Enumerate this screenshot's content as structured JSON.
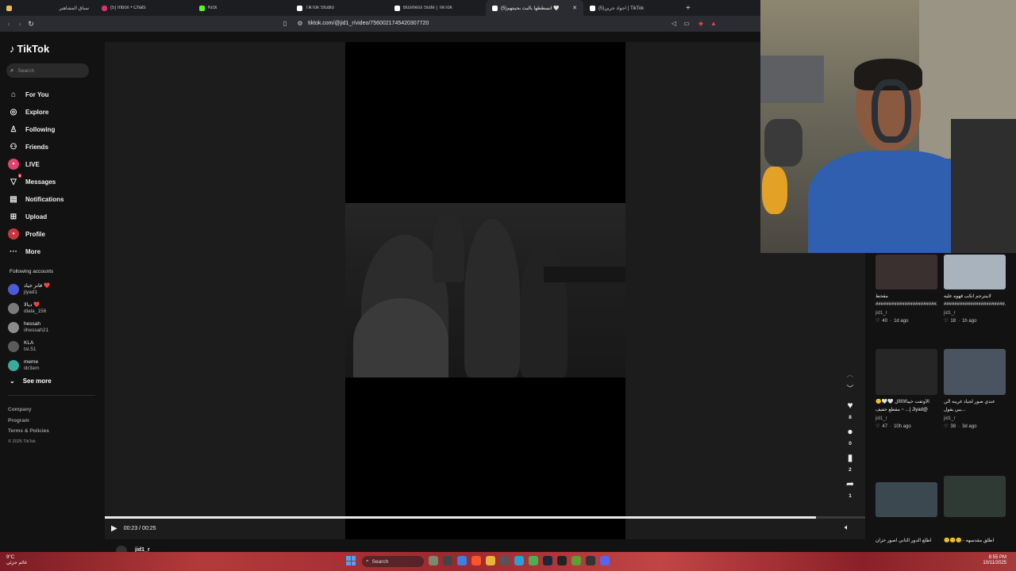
{
  "browser": {
    "tabs": [
      {
        "title": "سباق المشاهير",
        "favicon_color": "#e6c14a"
      },
      {
        "title": "(5) Inbox • Chats",
        "favicon_color": "#e1306c"
      },
      {
        "title": "Kick",
        "favicon_color": "#53fc18"
      },
      {
        "title": "TikTok Studio",
        "favicon_color": "#ffffff"
      },
      {
        "title": "Business Suite | TikTok",
        "favicon_color": "#ffffff"
      },
      {
        "title": "(5)انسطظها بالبث بحيبتهم 🤍",
        "favicon_color": "#ffffff",
        "active": true
      },
      {
        "title": "(5)اجواد جرين | TikTok",
        "favicon_color": "#ffffff"
      }
    ],
    "url": "tiktok.com/@jid1_r/video/7560021745420307720"
  },
  "sidebar": {
    "logo": "TikTok",
    "search_placeholder": "Search",
    "nav": [
      {
        "label": "For You",
        "icon": "home-icon"
      },
      {
        "label": "Explore",
        "icon": "compass-icon"
      },
      {
        "label": "Following",
        "icon": "following-icon"
      },
      {
        "label": "Friends",
        "icon": "friends-icon"
      },
      {
        "label": "LIVE",
        "icon": "live-icon"
      },
      {
        "label": "Messages",
        "icon": "messages-icon",
        "badge": "9"
      },
      {
        "label": "Notifications",
        "icon": "notifications-icon"
      },
      {
        "label": "Upload",
        "icon": "upload-icon"
      },
      {
        "label": "Profile",
        "icon": "profile-icon"
      },
      {
        "label": "More",
        "icon": "more-icon"
      }
    ],
    "following_title": "Following accounts",
    "accounts": [
      {
        "name": "فانز جياد ❤️",
        "handle": "jiyad1",
        "color": "#4b5bd6"
      },
      {
        "name": "ديالا ❤️",
        "handle": "diala_156",
        "color": "#7a7a7a"
      },
      {
        "name": "hessah",
        "handle": "iihessah21",
        "color": "#8c8c8c"
      },
      {
        "name": "KLA",
        "handle": "tsl.51",
        "color": "#5a5a5a"
      },
      {
        "name": "meme",
        "handle": "iitr3em",
        "color": "#3aa89a"
      }
    ],
    "see_more": "See more",
    "footer": [
      "Company",
      "Program",
      "Terms & Policies"
    ],
    "copyright": "© 2025 TikTok"
  },
  "player": {
    "time": "00:23 / 00:25",
    "progress": 0.935,
    "author": "jid1_r"
  },
  "actions": {
    "likes": "8",
    "comments": "0",
    "saves": "2",
    "shares": "1"
  },
  "recommendations": [
    {
      "title": "مقحط",
      "title2": "#######################...",
      "user": "jid1_r",
      "likes": "40",
      "age": "1d ago",
      "thumb": "#3a3030"
    },
    {
      "title": "لابيترجم انكب قهوه عليه",
      "title2": "#######################...",
      "user": "jid1_r",
      "likes": "18",
      "age": "1h ago",
      "thumb": "#a9b3bd"
    },
    {
      "title": "الأوتفت خيبالااااال 🤍🤍🙂",
      "title2": "@Jiyad |... ~ مقطع خفيف",
      "user": "jid1_r",
      "likes": "47",
      "age": "10h ago",
      "thumb": "#262626"
    },
    {
      "title": "عندي صور لجياد غريبه الي",
      "title2": "...يبي يقول",
      "user": "jid1_r",
      "likes": "38",
      "age": "3d ago",
      "thumb": "#4a5460"
    },
    {
      "title": "اطلع الدور الثاني اصور خزان",
      "title2": "",
      "user": "",
      "likes": "",
      "age": "",
      "thumb": "#3c4850"
    },
    {
      "title": "اطلق مقدسهه - 🙂🙂🙂",
      "title2": "",
      "user": "",
      "likes": "",
      "age": "",
      "thumb": "#2f3a35"
    }
  ],
  "taskbar": {
    "weather": "9°C",
    "weather_sub": "غائم جزئي",
    "search": "Search",
    "time": "8:55 PM",
    "date": "10/11/2025"
  }
}
